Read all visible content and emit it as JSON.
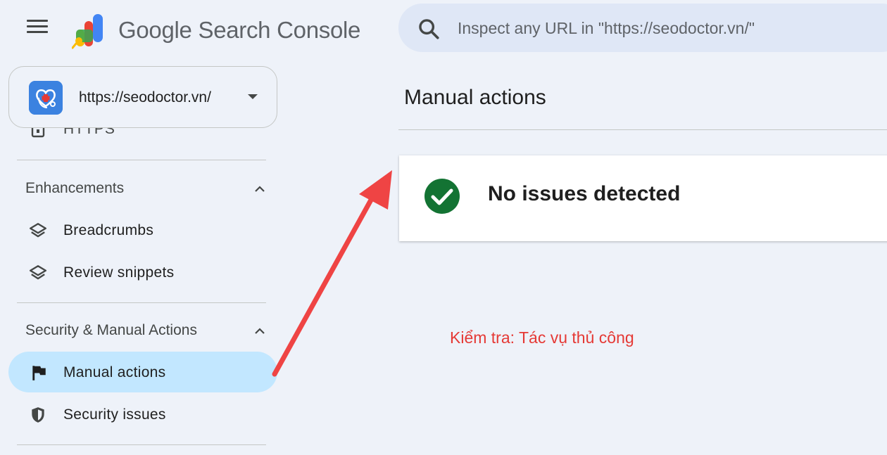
{
  "header": {
    "app_name": "Google Search Console",
    "search_placeholder": "Inspect any URL in \"https://seodoctor.vn/\""
  },
  "property": {
    "url": "https://seodoctor.vn/"
  },
  "sidebar": {
    "peek_item": {
      "label": "HTTPS"
    },
    "sections": [
      {
        "title": "Enhancements",
        "items": [
          {
            "label": "Breadcrumbs",
            "icon": "layers-icon"
          },
          {
            "label": "Review snippets",
            "icon": "layers-icon"
          }
        ]
      },
      {
        "title": "Security & Manual Actions",
        "items": [
          {
            "label": "Manual actions",
            "icon": "flag-icon",
            "active": true
          },
          {
            "label": "Security issues",
            "icon": "shield-icon"
          }
        ]
      }
    ]
  },
  "main": {
    "title": "Manual actions",
    "status": "No issues detected"
  },
  "annotation": {
    "text": "Kiểm tra: Tác vụ thủ công",
    "color": "#e53935"
  },
  "colors": {
    "background": "#eef2f9",
    "active_nav": "#c2e7ff",
    "success": "#137333",
    "search_bar": "#dfe7f6"
  }
}
